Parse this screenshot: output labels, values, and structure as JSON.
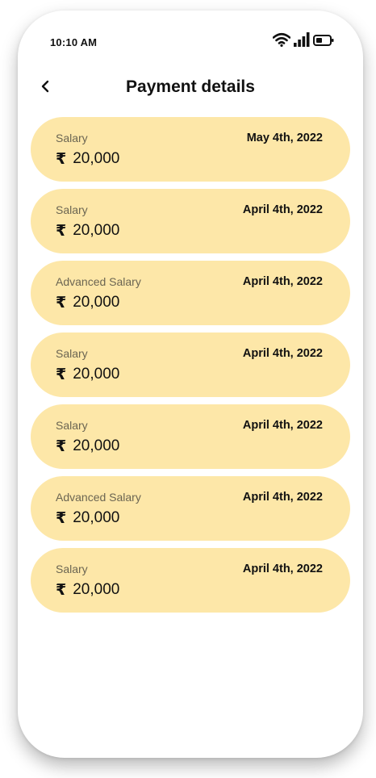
{
  "status_bar": {
    "time": "10:10 AM",
    "icons": [
      "wifi-icon",
      "signal-icon",
      "battery-icon"
    ]
  },
  "header": {
    "title": "Payment details",
    "back_icon": "chevron-left-icon"
  },
  "currency_symbol": "₹",
  "payments": [
    {
      "type": "Salary",
      "date": "May 4th, 2022",
      "amount": "20,000"
    },
    {
      "type": "Salary",
      "date": "April 4th, 2022",
      "amount": "20,000"
    },
    {
      "type": "Advanced Salary",
      "date": "April 4th, 2022",
      "amount": "20,000"
    },
    {
      "type": "Salary",
      "date": "April 4th, 2022",
      "amount": "20,000"
    },
    {
      "type": "Salary",
      "date": "April 4th, 2022",
      "amount": "20,000"
    },
    {
      "type": "Advanced Salary",
      "date": "April 4th, 2022",
      "amount": "20,000"
    },
    {
      "type": "Salary",
      "date": "April 4th, 2022",
      "amount": "20,000"
    }
  ],
  "colors": {
    "card_background": "#fde7a8",
    "text_primary": "#111111",
    "text_secondary": "#6b6552",
    "page_background": "#ffffff"
  }
}
